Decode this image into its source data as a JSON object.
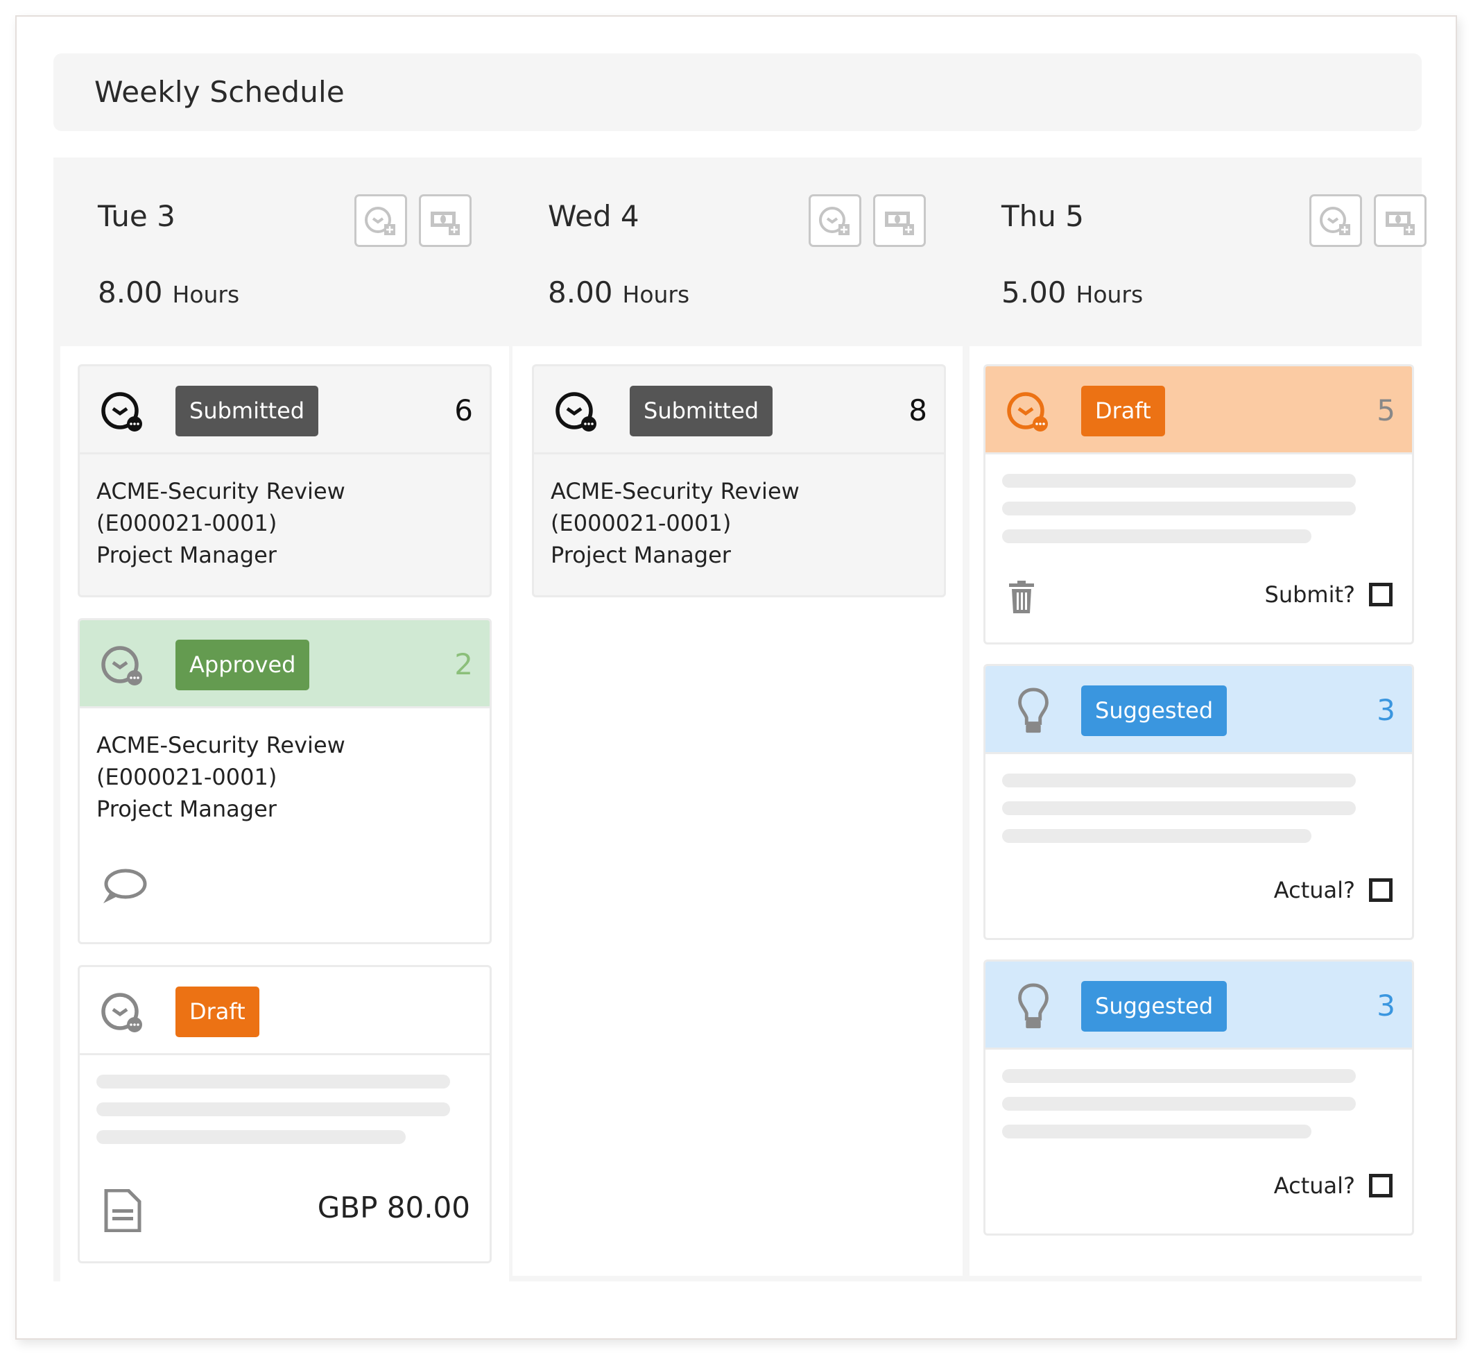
{
  "page": {
    "title": "Weekly Schedule"
  },
  "colors": {
    "submitted": "#555555",
    "approved": "#649b50",
    "approved_bg": "#d0e9d3",
    "approved_count": "#8bbf7a",
    "draft": "#ec7214",
    "draft_bg": "#fbcba3",
    "suggested": "#3a96df",
    "suggested_bg": "#d4e9fb"
  },
  "days": [
    {
      "name": "Tue 3",
      "hours_value": "8.00",
      "hours_unit": "Hours",
      "add_time_label": "add-time",
      "add_expense_label": "add-expense",
      "cards": [
        {
          "status": "Submitted",
          "count": "6",
          "project": "ACME-Security Review",
          "code": "(E000021-0001)",
          "role": "Project Manager"
        },
        {
          "status": "Approved",
          "count": "2",
          "project": "ACME-Security Review",
          "code": "(E000021-0001)",
          "role": "Project Manager",
          "icon": "comment-icon"
        },
        {
          "status": "Draft",
          "count": "",
          "amount": "GBP 80.00",
          "icon": "document-icon"
        }
      ]
    },
    {
      "name": "Wed 4",
      "hours_value": "8.00",
      "hours_unit": "Hours",
      "cards": [
        {
          "status": "Submitted",
          "count": "8",
          "project": "ACME-Security Review",
          "code": "(E000021-0001)",
          "role": "Project Manager"
        }
      ]
    },
    {
      "name": "Thu 5",
      "hours_value": "5.00",
      "hours_unit": "Hours",
      "cards": [
        {
          "status": "Draft",
          "count": "5",
          "checkbox_label": "Submit?",
          "checked": false,
          "icon": "trash-icon"
        },
        {
          "status": "Suggested",
          "count": "3",
          "checkbox_label": "Actual?",
          "checked": false
        },
        {
          "status": "Suggested",
          "count": "3",
          "checkbox_label": "Actual?",
          "checked": false
        }
      ]
    }
  ]
}
